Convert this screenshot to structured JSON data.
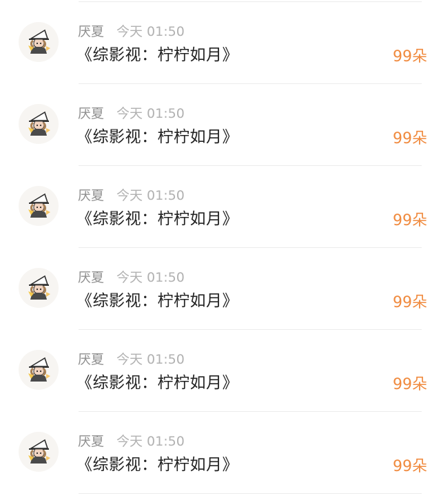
{
  "feed": {
    "items": [
      {
        "name": "厌夏",
        "time": "今天 01:50",
        "title": "《综影视：柠柠如月》",
        "gift": "99朵",
        "avatar_icon": "cartoon-witch-avatar-icon"
      },
      {
        "name": "厌夏",
        "time": "今天 01:50",
        "title": "《综影视：柠柠如月》",
        "gift": "99朵",
        "avatar_icon": "cartoon-witch-avatar-icon"
      },
      {
        "name": "厌夏",
        "time": "今天 01:50",
        "title": "《综影视：柠柠如月》",
        "gift": "99朵",
        "avatar_icon": "cartoon-witch-avatar-icon"
      },
      {
        "name": "厌夏",
        "time": "今天 01:50",
        "title": "《综影视：柠柠如月》",
        "gift": "99朵",
        "avatar_icon": "cartoon-witch-avatar-icon"
      },
      {
        "name": "厌夏",
        "time": "今天 01:50",
        "title": "《综影视：柠柠如月》",
        "gift": "99朵",
        "avatar_icon": "cartoon-witch-avatar-icon"
      },
      {
        "name": "厌夏",
        "time": "今天 01:50",
        "title": "《综影视：柠柠如月》",
        "gift": "99朵",
        "avatar_icon": "cartoon-witch-avatar-icon"
      }
    ]
  },
  "colors": {
    "accent_gift": "#f08a3e",
    "meta_text": "#9a9a9a",
    "title_text": "#222222",
    "divider": "#ececec",
    "background": "#ffffff"
  }
}
